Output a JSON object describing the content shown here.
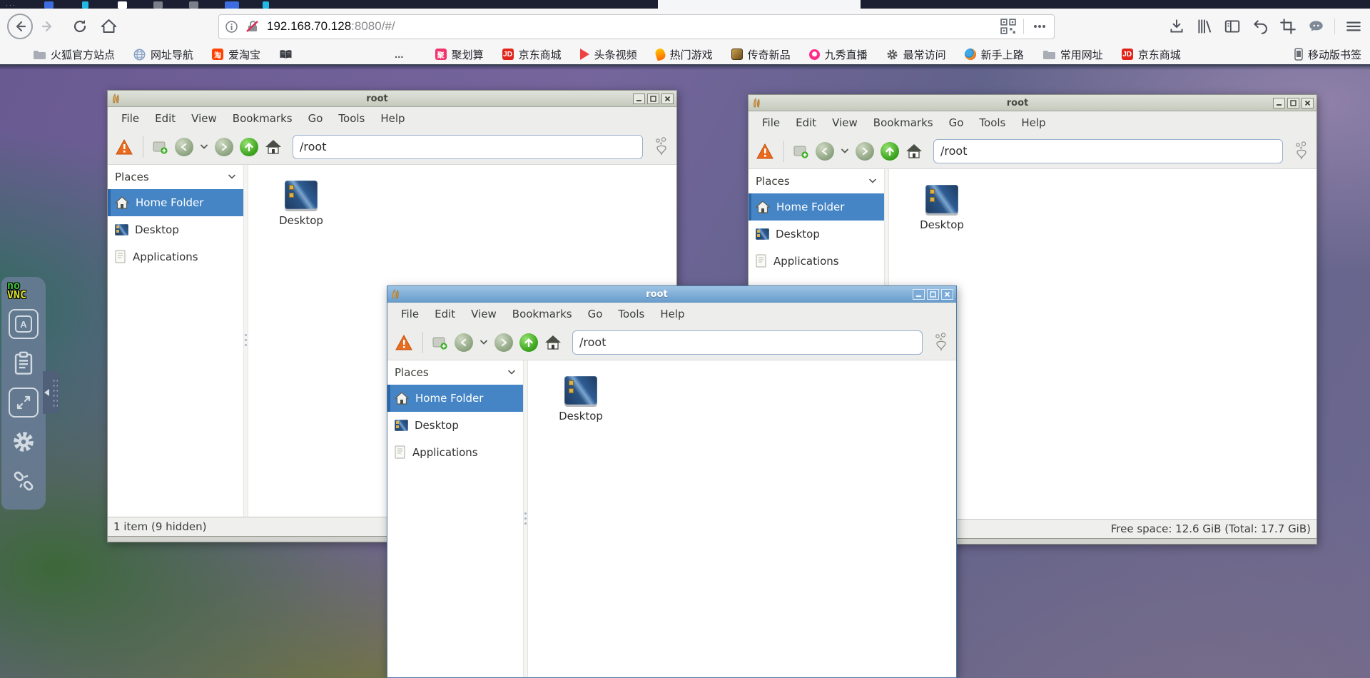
{
  "browser": {
    "nav": {
      "url_host": "192.168.70.128",
      "url_suffix": ":8080/#/"
    },
    "bookmarks": [
      {
        "label": "火狐官方站点",
        "icon": "folder"
      },
      {
        "label": "网址导航",
        "icon": "globe"
      },
      {
        "label": "爱淘宝",
        "icon": "taobao",
        "icon_text": "淘",
        "icon_color": "#ff4200"
      },
      {
        "label": "",
        "icon": "book"
      },
      {
        "label": "聚划算",
        "icon": "ju",
        "icon_text": "聚",
        "icon_color": "#f2346c"
      },
      {
        "label": "京东商城",
        "icon": "jd",
        "icon_text": "JD",
        "icon_color": "#e1251b"
      },
      {
        "label": "头条视频",
        "icon": "play",
        "icon_color": "#f04142"
      },
      {
        "label": "热门游戏",
        "icon": "flame",
        "icon_color": "#ff8a00"
      },
      {
        "label": "传奇新品",
        "icon": "legend",
        "icon_color": "#8a6a3a"
      },
      {
        "label": "九秀直播",
        "icon": "pin",
        "icon_color": "#ff2d88"
      },
      {
        "label": "最常访问",
        "icon": "gear",
        "icon_color": "#5a5a5a"
      },
      {
        "label": "新手上路",
        "icon": "firefox"
      },
      {
        "label": "常用网址",
        "icon": "folder"
      },
      {
        "label": "京东商城",
        "icon": "jd",
        "icon_text": "JD",
        "icon_color": "#e1251b"
      },
      {
        "label": "移动版书签",
        "icon": "phone"
      }
    ],
    "bookmarks_overflow": "..."
  },
  "novnc": {
    "logo_line1": "no",
    "logo_line2": "VNC",
    "extra_keys_label": "A",
    "buttons": [
      "extra-keys",
      "clipboard",
      "fullscreen",
      "settings",
      "disconnect"
    ]
  },
  "windows": [
    {
      "title": "root",
      "active": false,
      "menu": [
        "File",
        "Edit",
        "View",
        "Bookmarks",
        "Go",
        "Tools",
        "Help"
      ],
      "path": "/root",
      "places_label": "Places",
      "places": [
        "Home Folder",
        "Desktop",
        "Applications"
      ],
      "selected_place": "Home Folder",
      "files": [
        {
          "name": "Desktop"
        }
      ],
      "status": "1 item (9 hidden)"
    },
    {
      "title": "root",
      "active": false,
      "menu": [
        "File",
        "Edit",
        "View",
        "Bookmarks",
        "Go",
        "Tools",
        "Help"
      ],
      "path": "/root",
      "places_label": "Places",
      "places": [
        "Home Folder",
        "Desktop",
        "Applications"
      ],
      "selected_place": "Home Folder",
      "files": [
        {
          "name": "Desktop"
        }
      ],
      "status": "Free space: 12.6 GiB (Total: 17.7 GiB)"
    },
    {
      "title": "root",
      "active": true,
      "menu": [
        "File",
        "Edit",
        "View",
        "Bookmarks",
        "Go",
        "Tools",
        "Help"
      ],
      "path": "/root",
      "places_label": "Places",
      "places": [
        "Home Folder",
        "Desktop",
        "Applications"
      ],
      "selected_place": "Home Folder",
      "files": [
        {
          "name": "Desktop"
        }
      ]
    }
  ],
  "colors": {
    "selection_blue": "#4585c5",
    "active_titlebar": "#7fafd6",
    "inactive_titlebar": "#ccd0c4",
    "warning_orange": "#ea6b1d",
    "tabstrip_bg": "#1c1f31"
  }
}
